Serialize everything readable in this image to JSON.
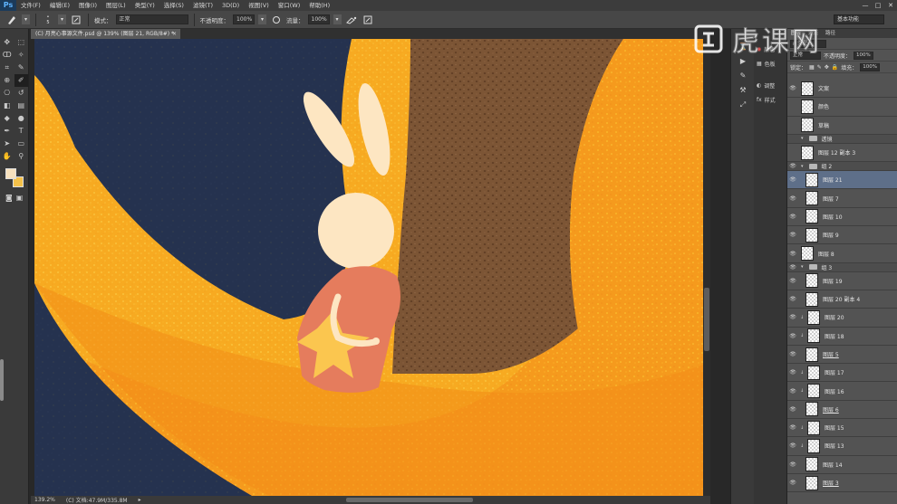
{
  "app": {
    "logo": "Ps",
    "menu": [
      "文件(F)",
      "编辑(E)",
      "图像(I)",
      "图层(L)",
      "类型(Y)",
      "选择(S)",
      "滤镜(T)",
      "3D(D)",
      "视图(V)",
      "窗口(W)",
      "帮助(H)"
    ],
    "window_controls": [
      "—",
      "□",
      "✕"
    ]
  },
  "options_bar": {
    "mode_label": "模式：",
    "mode_value": "正常",
    "opacity_label": "不透明度：",
    "opacity_value": "100%",
    "flow_label": "流量：",
    "flow_value": "100%",
    "brush_size": "5",
    "workspace": "基本功能"
  },
  "watermark": {
    "text": "虎课网"
  },
  "document": {
    "tab_title": "(C) 月亮心事源文件.psd @ 139% (图层 21, RGB/8#) *",
    "close": "×"
  },
  "status": {
    "zoom": "139.2%",
    "doc_info": "(C) 文档:47.9M/335.8M"
  },
  "side_panel": {
    "items": [
      {
        "icon": "adjust-icon",
        "label": "调整"
      },
      {
        "icon": "styles-icon",
        "label": "样式"
      }
    ],
    "top_labels": [
      "颜色",
      "色板"
    ]
  },
  "layers_panel": {
    "tabs": [
      "图层",
      "通道",
      "路径"
    ],
    "filter_label": "ρ 类型",
    "blend_mode": "正常",
    "opacity_label": "不透明度：",
    "opacity_value": "100%",
    "lock_label": "锁定：",
    "fill_label": "填充：",
    "fill_value": "100%",
    "layers": [
      {
        "name": "文案",
        "visible": true,
        "type": "layer",
        "indent": 0
      },
      {
        "name": "颜色",
        "visible": false,
        "type": "layer",
        "indent": 0
      },
      {
        "name": "草稿",
        "visible": false,
        "type": "layer",
        "indent": 0
      },
      {
        "name": "透镜",
        "visible": false,
        "type": "group",
        "indent": 0
      },
      {
        "name": "图层 12 副本 3",
        "visible": false,
        "type": "layer",
        "indent": 0
      },
      {
        "name": "组 2",
        "visible": true,
        "type": "group",
        "indent": 0
      },
      {
        "name": "图层 21",
        "visible": true,
        "type": "layer",
        "indent": 1,
        "selected": true
      },
      {
        "name": "图层 7",
        "visible": true,
        "type": "layer",
        "indent": 1
      },
      {
        "name": "图层 10",
        "visible": true,
        "type": "layer",
        "indent": 1
      },
      {
        "name": "图层 9",
        "visible": true,
        "type": "layer",
        "indent": 1
      },
      {
        "name": "图层 8",
        "visible": true,
        "type": "layer",
        "indent": 0
      },
      {
        "name": "组 3",
        "visible": true,
        "type": "group",
        "indent": 0
      },
      {
        "name": "图层 19",
        "visible": true,
        "type": "layer",
        "indent": 1
      },
      {
        "name": "图层 20 副本 4",
        "visible": true,
        "type": "layer",
        "indent": 1
      },
      {
        "name": "图层 20",
        "visible": true,
        "type": "layer",
        "indent": 1,
        "clipped": true
      },
      {
        "name": "图层 18",
        "visible": true,
        "type": "layer",
        "indent": 1,
        "clipped": true
      },
      {
        "name": "图层 5",
        "visible": true,
        "type": "layer",
        "indent": 1,
        "underline": true
      },
      {
        "name": "图层 17",
        "visible": true,
        "type": "layer",
        "indent": 1,
        "clipped": true
      },
      {
        "name": "图层 16",
        "visible": true,
        "type": "layer",
        "indent": 1,
        "clipped": true
      },
      {
        "name": "图层 6",
        "visible": true,
        "type": "layer",
        "indent": 1,
        "underline": true
      },
      {
        "name": "图层 15",
        "visible": true,
        "type": "layer",
        "indent": 1,
        "clipped": true
      },
      {
        "name": "图层 13",
        "visible": true,
        "type": "layer",
        "indent": 1,
        "clipped": true
      },
      {
        "name": "图层 14",
        "visible": true,
        "type": "layer",
        "indent": 1
      },
      {
        "name": "图层 3",
        "visible": true,
        "type": "layer",
        "indent": 1,
        "underline": true
      }
    ]
  },
  "colors": {
    "foreground": "#f7e1bd",
    "background": "#f4c14a",
    "canvas_navy": "#25324f",
    "canvas_orange": "#f59a1d",
    "canvas_brown": "#7a5234",
    "rabbit_cream": "#fde6c2",
    "dress_coral": "#e57c5d",
    "star_yellow": "#fbc64f"
  }
}
